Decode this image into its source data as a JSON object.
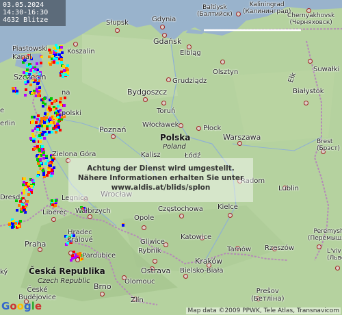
{
  "header": {
    "date": "03.05.2024",
    "time_range": "14:30-16:30",
    "strike_count": "4632 Blitze"
  },
  "notice": {
    "line1": "Achtung der Dienst wird umgestellt.",
    "line2": "Nähere Informationen erhalten Sie unter",
    "line3": "www.aldis.at/blids/splon"
  },
  "countries": {
    "poland": "Polska",
    "poland_sub": "Poland",
    "czech": "Česká Republika",
    "czech_sub": "Czech Republic"
  },
  "cities": {
    "baltiysk": "Baltiysk",
    "baltiysk_ru": "(Балтийск)",
    "kaliningrad": "Kaliningrad",
    "kaliningrad_ru": "(Калининград)",
    "chernyakhovsk": "Chernyakhovsk",
    "chernyakhovsk_ru": "(Черняховск)",
    "gdynia": "Gdynia",
    "slupsk": "Słupsk",
    "gdansk": "Gdańsk",
    "elblag": "Elbląg",
    "piastowski": "Piastowski",
    "kanal": "Kanal",
    "koszalin": "Koszalin",
    "suwalki": "Suwałki",
    "szczecin": "Szczecin",
    "grudziadz": "Grudziądz",
    "olsztyn": "Olsztyn",
    "elk": "Ełk",
    "bydgoszcz": "Bydgoszcz",
    "torun": "Toruń",
    "bialystok": "Białystok",
    "berlin_frag": "erlin",
    "poznan": "Poznań",
    "wloclawek": "Włocławek",
    "plock": "Płock",
    "warszawa": "Warszawa",
    "brest": "Brest",
    "brest_ru": "(Брэст)",
    "zielona_gora": "Zielona Góra",
    "kalisz": "Kalisz",
    "lodz": "Łódź",
    "wroclaw": "Wrocław",
    "radom": "Radom",
    "lublin": "Lublin",
    "dresden_frag": "Dresd",
    "legnica": "Legnica",
    "walbrzych": "Wałbrzych",
    "czestochowa": "Częstochowa",
    "kielce": "Kielce",
    "opole": "Opole",
    "liberec": "Liberec",
    "hradec_kralove": "Hradec\nKrálové",
    "gliwice": "Gliwice",
    "katowice": "Katowice",
    "tarnow": "Tarnów",
    "rzeszow": "Rzeszów",
    "peremyshl": "Peremyshl",
    "peremyshl_ru": "(Перемышль)",
    "praha": "Praha",
    "rybnik": "Rybnik",
    "krakow": "Kraków",
    "lviv": "L'viv",
    "lviv_ru": "(Львов)",
    "pardubice": "Pardubice",
    "ostrava": "Ostrava",
    "bielsko_biala": "Bielsko-Biała",
    "olomouc": "Olomouc",
    "brno": "Brno",
    "zlin": "Zlín",
    "presov": "Prešov",
    "presov_ru": "(Бетліна)",
    "ceske_budejovice": "České\nBudějovice",
    "frag_na": "na",
    "frag_polski": "polski",
    "frag_kanal2": "Kanal",
    "frag_e": "e",
    "frag_ky": "ký"
  },
  "map_credit": "Map data ©2009 PPWK, Tele Atlas, Transnavicom",
  "logo": "Google",
  "colors": {
    "land": "#b5d29f",
    "sea": "#99b3cc",
    "city_dot_ring": "#a02020",
    "lightning_palette": [
      "#ff0000",
      "#ff7700",
      "#ffd400",
      "#00c800",
      "#0000ff",
      "#b400ff",
      "#00ffff"
    ]
  }
}
